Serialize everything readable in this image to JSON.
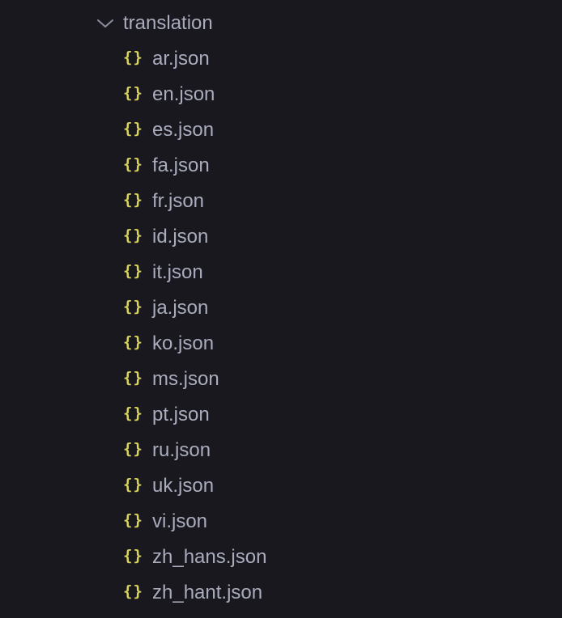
{
  "folder": {
    "name": "translation",
    "expanded": true,
    "icon": "chevron-down-icon"
  },
  "colors": {
    "background": "#18181e",
    "label": "#a9acbd",
    "json_icon": "#d7d45d",
    "chevron": "#8b8e9c"
  },
  "files": [
    {
      "name": "ar.json",
      "icon": "json-braces-icon",
      "glyph": "{}"
    },
    {
      "name": "en.json",
      "icon": "json-braces-icon",
      "glyph": "{}"
    },
    {
      "name": "es.json",
      "icon": "json-braces-icon",
      "glyph": "{}"
    },
    {
      "name": "fa.json",
      "icon": "json-braces-icon",
      "glyph": "{}"
    },
    {
      "name": "fr.json",
      "icon": "json-braces-icon",
      "glyph": "{}"
    },
    {
      "name": "id.json",
      "icon": "json-braces-icon",
      "glyph": "{}"
    },
    {
      "name": "it.json",
      "icon": "json-braces-icon",
      "glyph": "{}"
    },
    {
      "name": "ja.json",
      "icon": "json-braces-icon",
      "glyph": "{}"
    },
    {
      "name": "ko.json",
      "icon": "json-braces-icon",
      "glyph": "{}"
    },
    {
      "name": "ms.json",
      "icon": "json-braces-icon",
      "glyph": "{}"
    },
    {
      "name": "pt.json",
      "icon": "json-braces-icon",
      "glyph": "{}"
    },
    {
      "name": "ru.json",
      "icon": "json-braces-icon",
      "glyph": "{}"
    },
    {
      "name": "uk.json",
      "icon": "json-braces-icon",
      "glyph": "{}"
    },
    {
      "name": "vi.json",
      "icon": "json-braces-icon",
      "glyph": "{}"
    },
    {
      "name": "zh_hans.json",
      "icon": "json-braces-icon",
      "glyph": "{}"
    },
    {
      "name": "zh_hant.json",
      "icon": "json-braces-icon",
      "glyph": "{}"
    }
  ]
}
